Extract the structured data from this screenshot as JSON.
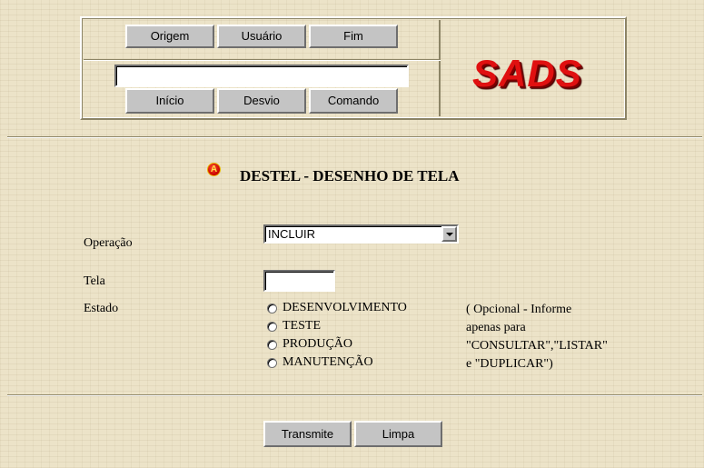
{
  "nav": {
    "buttons_top": [
      "Origem",
      "Usuário",
      "Fim"
    ],
    "buttons_bottom": [
      "Início",
      "Desvio",
      "Comando"
    ],
    "command_value": ""
  },
  "logo": {
    "text": "SADS"
  },
  "page": {
    "marker": "A",
    "title": "DESTEL - DESENHO DE TELA"
  },
  "form": {
    "operacao_label": "Operação",
    "operacao_value": "INCLUIR",
    "tela_label": "Tela",
    "tela_value": "",
    "estado_label": "Estado",
    "estado_options": [
      "DESENVOLVIMENTO",
      "TESTE",
      "PRODUÇÃO",
      "MANUTENÇÃO"
    ],
    "note_lines": [
      "( Opcional - Informe",
      "apenas para",
      "\"CONSULTAR\",\"LISTAR\"",
      "e \"DUPLICAR\")"
    ]
  },
  "actions": {
    "transmit_label": "Transmite",
    "clear_label": "Limpa"
  },
  "colors": {
    "background": "#ece3c8",
    "button": "#c4c4c4",
    "logo": "#e01010",
    "marker": "#d40000"
  }
}
